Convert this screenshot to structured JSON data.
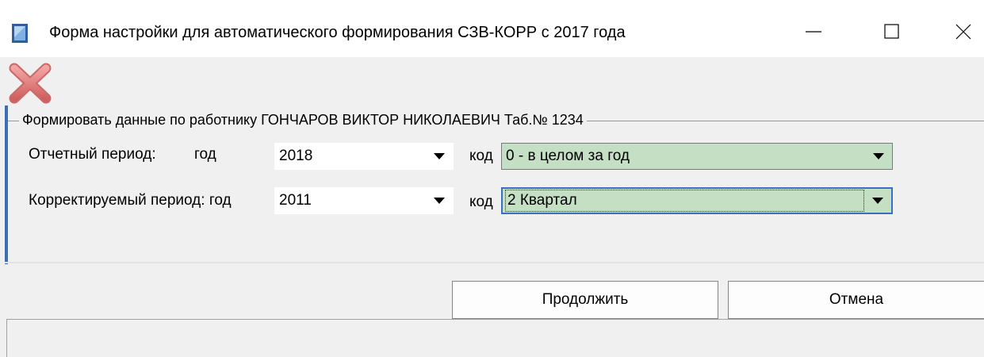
{
  "window": {
    "title": "Форма настройки для автоматического формирования СЗВ-КОРР с 2017 года",
    "icon": "app-document-icon",
    "controls": [
      "minimize-icon",
      "maximize-icon",
      "close-icon"
    ]
  },
  "toolbar": {
    "icon": "red-x-delete-icon"
  },
  "group": {
    "legend": "Формировать данные по работнику ГОНЧАРОВ ВИКТОР НИКОЛАЕВИЧ Таб.№ 1234"
  },
  "reporting": {
    "label": "Отчетный период:",
    "year_label": "год",
    "year_value": "2018",
    "code_label": "код",
    "code_value": "0 - в целом за год"
  },
  "corrected": {
    "label": "Корректируемый период: год",
    "year_value": "2011",
    "code_label": "код",
    "code_value": "2 Квартал"
  },
  "buttons": {
    "continue": "Продолжить",
    "cancel": "Отмена"
  },
  "colors": {
    "combo_green": "#c5dfc5",
    "accent_bar": "#3c6fb4"
  }
}
